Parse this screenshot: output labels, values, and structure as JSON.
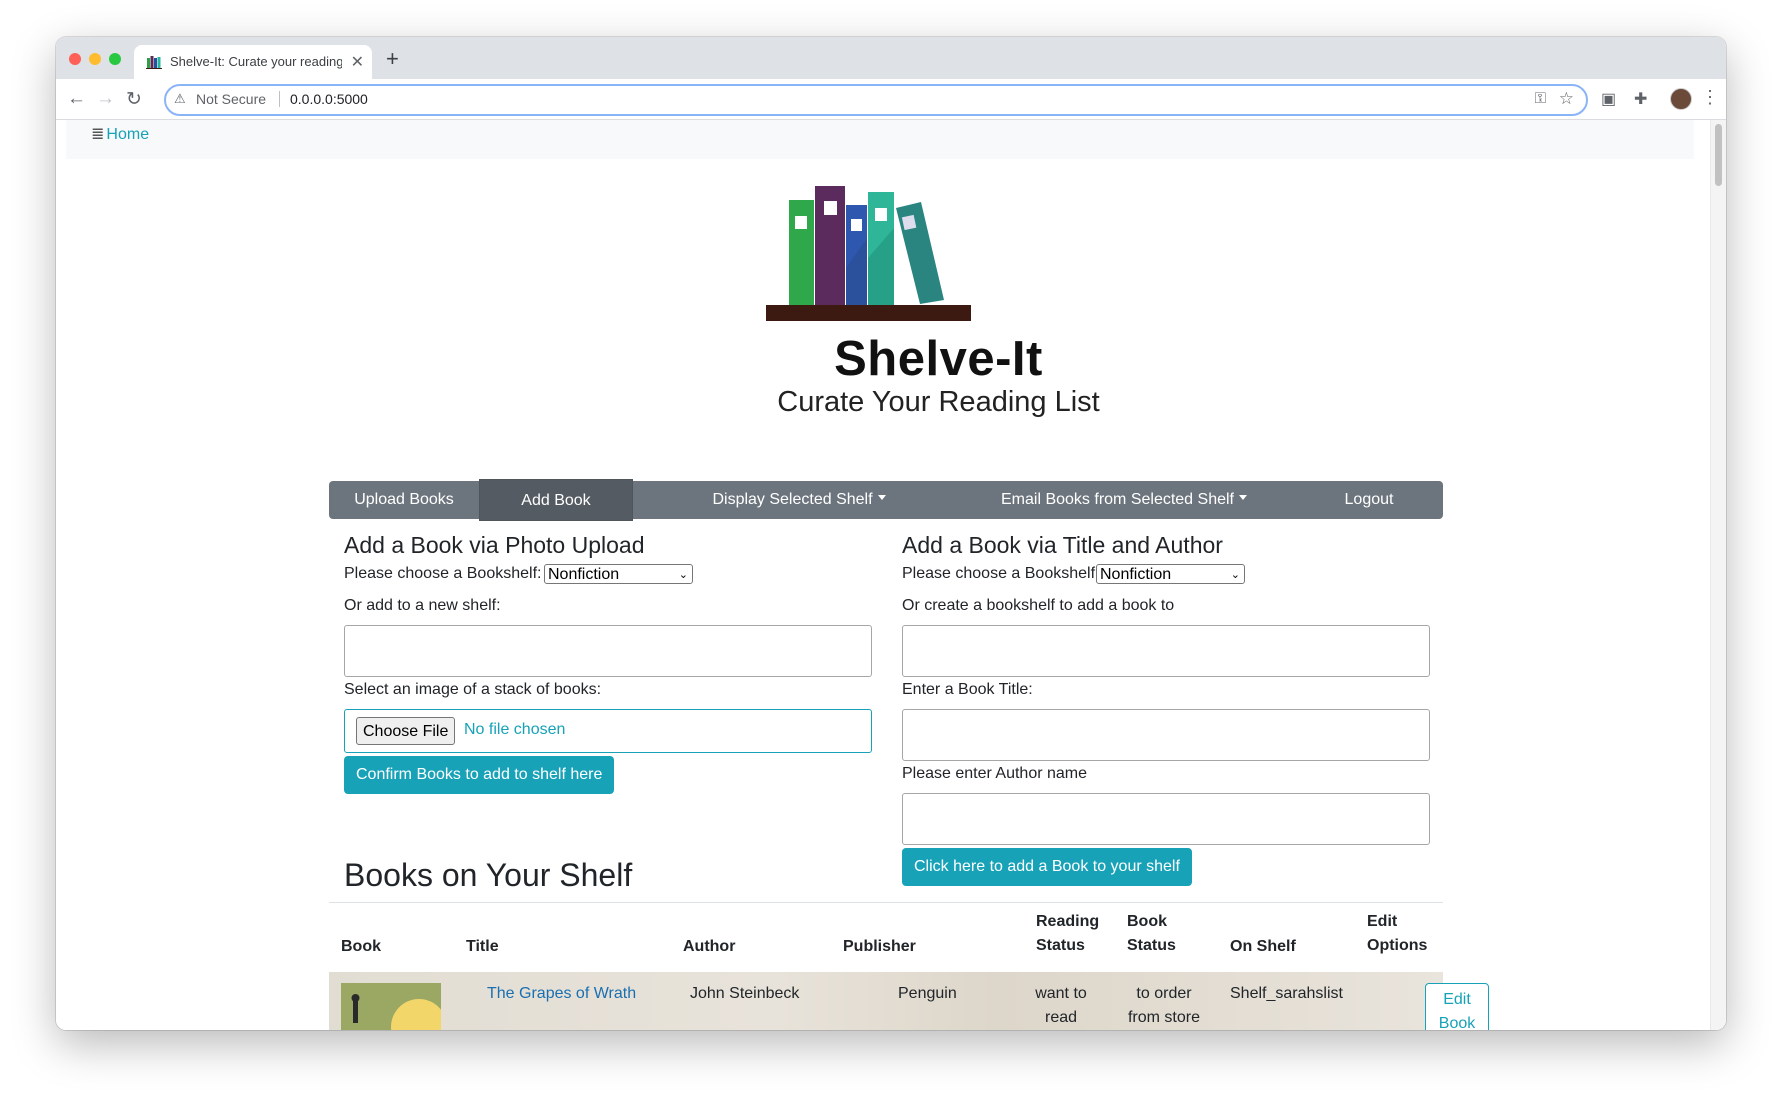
{
  "browser": {
    "tab_title": "Shelve-It: Curate your reading list",
    "tab_close": "✕",
    "new_tab": "+",
    "security_label": "Not Secure",
    "url": "0.0.0.0:5000"
  },
  "topnav": {
    "home_label": "Home"
  },
  "brand": {
    "title": "Shelve-It",
    "subtitle": "Curate Your Reading List"
  },
  "menu": {
    "items": [
      "Upload Books",
      "Add Book",
      "Display Selected Shelf",
      "Email Books from Selected Shelf",
      "Logout"
    ],
    "active": "Add Book"
  },
  "photo_upload": {
    "heading": "Add a Book via Photo Upload",
    "shelf_label": "Please choose a Bookshelf:",
    "shelf_value": "Nonfiction",
    "new_shelf_label": "Or add to a new shelf:",
    "new_shelf_value": "",
    "image_label": "Select an image of a stack of books:",
    "choose_file_label": "Choose File",
    "file_status": "No file chosen",
    "confirm_button": "Confirm Books to add to shelf here"
  },
  "title_author": {
    "heading": "Add a Book via Title and Author",
    "shelf_label": "Please choose a Bookshelf",
    "shelf_value": "Nonfiction",
    "create_shelf_label": "Or create a bookshelf to add a book to",
    "title_label": "Enter a Book Title:",
    "author_label": "Please enter Author name",
    "submit_button": "Click here to add a Book to your shelf"
  },
  "shelf_table": {
    "heading": "Books on Your Shelf",
    "columns": {
      "book": "Book",
      "title": "Title",
      "author": "Author",
      "publisher": "Publisher",
      "reading_status_1": "Reading",
      "reading_status_2": "Status",
      "book_status_1": "Book",
      "book_status_2": "Status",
      "on_shelf": "On Shelf",
      "edit_options_1": "Edit",
      "edit_options_2": "Options"
    },
    "rows": [
      {
        "title": "The Grapes of Wrath",
        "author": "John Steinbeck",
        "publisher": "Penguin",
        "reading_status_1": "want to",
        "reading_status_2": "read",
        "book_status_1": "to order",
        "book_status_2": "from store",
        "on_shelf": "Shelf_sarahslist",
        "edit_1": "Edit",
        "edit_2": "Book"
      }
    ]
  },
  "colors": {
    "accent": "#17a2b8",
    "menubar": "#6c757d",
    "menubar_active": "#545b62"
  }
}
